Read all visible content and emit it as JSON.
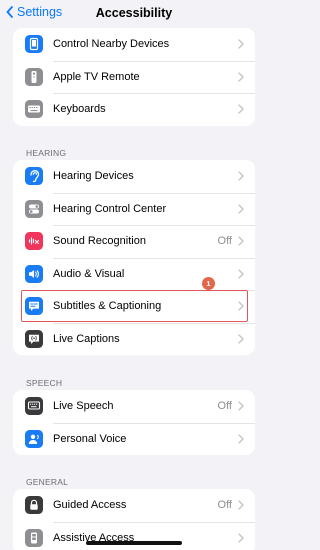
{
  "nav": {
    "back_label": "Settings",
    "title": "Accessibility"
  },
  "groups": {
    "top": [
      {
        "label": "Control Nearby Devices"
      },
      {
        "label": "Apple TV Remote"
      },
      {
        "label": "Keyboards"
      }
    ],
    "hearing": {
      "header": "HEARING",
      "items": [
        {
          "label": "Hearing Devices"
        },
        {
          "label": "Hearing Control Center"
        },
        {
          "label": "Sound Recognition",
          "value": "Off"
        },
        {
          "label": "Audio & Visual"
        },
        {
          "label": "Subtitles & Captioning"
        },
        {
          "label": "Live Captions"
        }
      ]
    },
    "speech": {
      "header": "SPEECH",
      "items": [
        {
          "label": "Live Speech",
          "value": "Off"
        },
        {
          "label": "Personal Voice"
        }
      ]
    },
    "general": {
      "header": "GENERAL",
      "items": [
        {
          "label": "Guided Access",
          "value": "Off"
        },
        {
          "label": "Assistive Access"
        }
      ]
    }
  },
  "annotation": {
    "badge": "1"
  },
  "colors": {
    "accent": "#0a7aff",
    "icon_blue": "#1a7cf5",
    "icon_gray": "#8e8e93",
    "icon_pink": "#f0365b",
    "icon_dark": "#3a3a3c",
    "highlight": "#e0585c",
    "badge": "#e2674a"
  },
  "icons": {
    "back": "chevron-left-icon",
    "control_nearby_devices": "device-icon",
    "apple_tv_remote": "remote-icon",
    "keyboards": "keyboard-icon",
    "hearing_devices": "ear-icon",
    "hearing_control_center": "toggles-icon",
    "sound_recognition": "waveform-icon",
    "audio_visual": "speaker-icon",
    "subtitles_captioning": "caption-bubble-icon",
    "live_captions": "live-caption-icon",
    "live_speech": "keyboard-speech-icon",
    "personal_voice": "person-voice-icon",
    "guided_access": "lock-icon",
    "assistive_access": "assistive-access-icon"
  }
}
